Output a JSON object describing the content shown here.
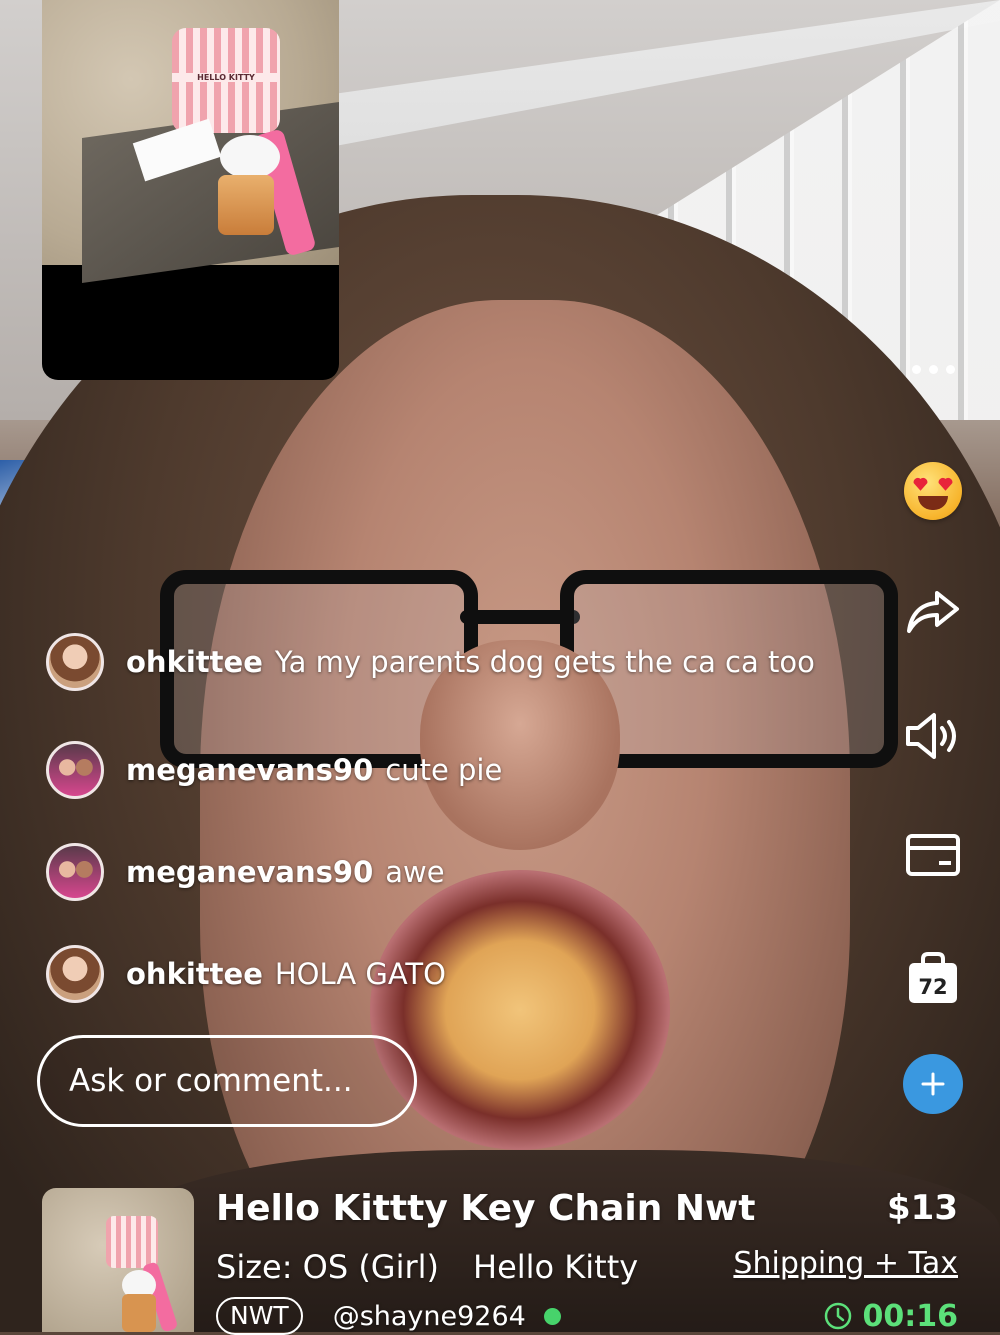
{
  "icons": {
    "more": "more-dots-icon",
    "reaction": "heart-eyes-emoji-icon",
    "share": "share-arrow-icon",
    "sound": "speaker-icon",
    "payment": "credit-card-icon",
    "bag": "shopping-bag-icon",
    "add": "plus-icon",
    "timer": "clock-icon"
  },
  "colors": {
    "accent_blue": "#3a98e0",
    "timer_green": "#5ce07a",
    "live_dot": "#47d36b"
  },
  "bag_count": "72",
  "chat": [
    {
      "user": "ohkittee",
      "text": "Ya my parents dog gets the ca ca too"
    },
    {
      "user": "meganevans90",
      "text": "cute pie"
    },
    {
      "user": "meganevans90",
      "text": "awe"
    },
    {
      "user": "ohkittee",
      "text": "HOLA GATO"
    }
  ],
  "comment": {
    "placeholder": "Ask or comment..."
  },
  "pip_card_label": "HELLO KITTY",
  "product": {
    "title": "Hello Kittty Key Chain Nwt",
    "price": "$13",
    "size": "Size: OS (Girl)",
    "brand": "Hello Kitty",
    "shipping": "Shipping + Tax",
    "condition": "NWT",
    "seller": "@shayne9264",
    "timer": "00:16"
  }
}
